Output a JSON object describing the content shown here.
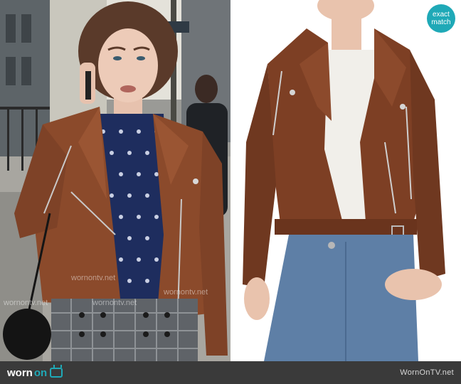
{
  "badge": {
    "line1": "exact",
    "line2": "match"
  },
  "watermarks": {
    "text": "wornontv.net"
  },
  "footer": {
    "logo_word1": "worn",
    "logo_word2": "on",
    "site": "WornOnTV.net"
  },
  "colors": {
    "accent": "#1fa9b7",
    "footer_bg": "#3a3a3a",
    "jacket": "#8b4a2b"
  },
  "icons": {
    "tv": "tv-icon"
  }
}
